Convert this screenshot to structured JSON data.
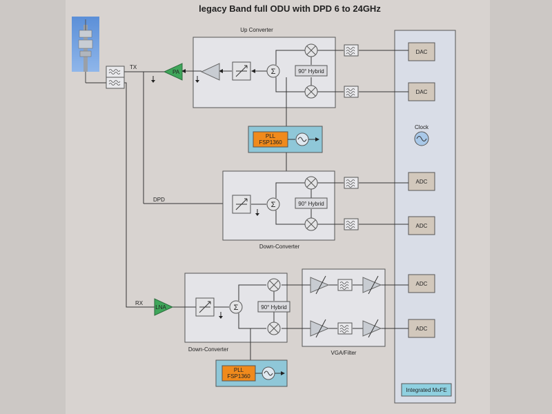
{
  "title": "legacy Band full ODU with DPD 6 to 24GHz",
  "labels": {
    "up_converter": "Up Converter",
    "down_converter": "Down-Converter",
    "vga_filter": "VGA/Filter",
    "tx": "TX",
    "rx": "RX",
    "dpd": "DPD",
    "pa": "PA",
    "lna": "LNA",
    "hybrid": "90° Hybrid",
    "pll_line1": "PLL",
    "pll_line2": "FSP1360",
    "clock": "Clock",
    "dac": "DAC",
    "adc": "ADC",
    "mxfe": "Integrated MxFE",
    "sigma": "Σ"
  }
}
